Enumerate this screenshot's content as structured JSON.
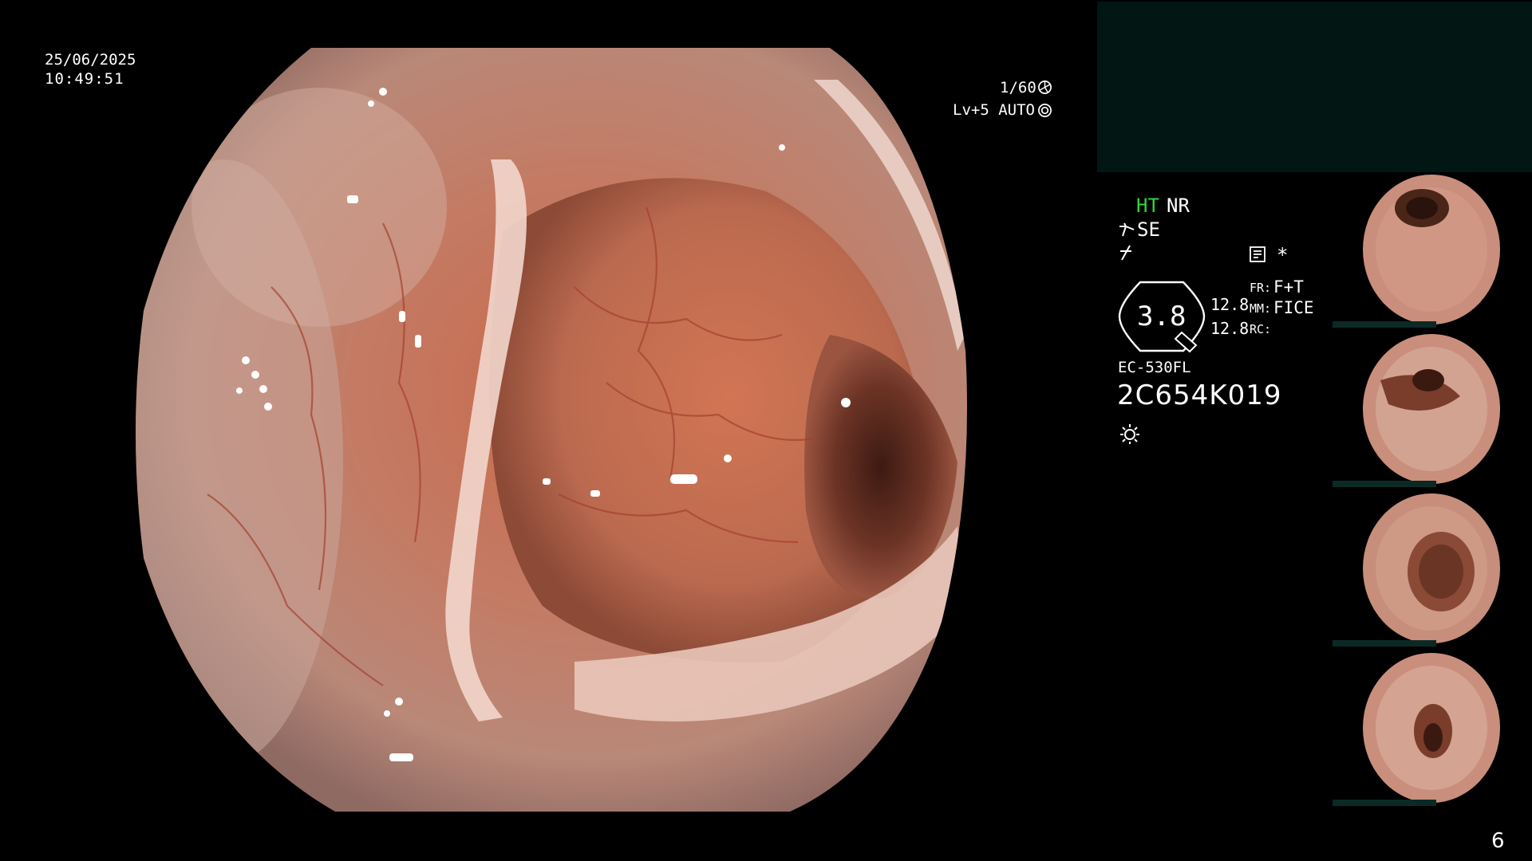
{
  "overlay": {
    "date": "25/06/2025",
    "time": "10:49:51",
    "shutter": "1/60",
    "level": "Lv+5 AUTO"
  },
  "status": {
    "ht": "HT",
    "nr": "NR",
    "se": "SE",
    "star": "*",
    "zoom": "3.8",
    "value_top": "12.8",
    "value_bottom": "12.8",
    "fr_label": "FR:",
    "fr_value": "F+T",
    "mm_label": "MM:",
    "mm_value": "FICE",
    "rc_label": "RC:"
  },
  "scope": {
    "model": "EC-530FL",
    "serial": "2C654K019"
  },
  "page_number": "6",
  "colors": {
    "ht": "#35d43a",
    "panel_top": "#021614",
    "thumb_strip": "#0b2a26"
  },
  "icons": [
    "shutter-icon",
    "auto-iris-icon",
    "enhance-icon",
    "frequency-icon",
    "memo-icon",
    "zoom-icon",
    "light-icon"
  ]
}
